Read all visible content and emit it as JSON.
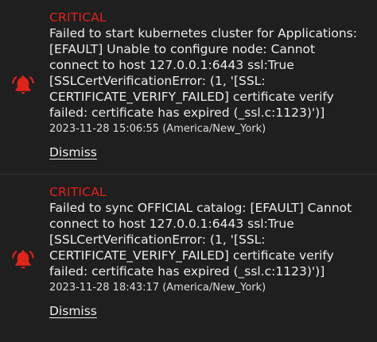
{
  "alerts": [
    {
      "level": "CRITICAL",
      "message": "Failed to start kubernetes cluster for Applications:\n[EFAULT] Unable to configure node: Cannot\nconnect to host 127.0.0.1:6443 ssl:True\n[SSLCertVerificationError: (1, '[SSL:\nCERTIFICATE_VERIFY_FAILED] certificate verify\nfailed: certificate has expired (_ssl.c:1123)')]",
      "timestamp": "2023-11-28 15:06:55 (America/New_York)",
      "dismiss_label": "Dismiss",
      "icon": "bell-icon"
    },
    {
      "level": "CRITICAL",
      "message": "Failed to sync OFFICIAL catalog: [EFAULT] Cannot\nconnect to host 127.0.0.1:6443 ssl:True\n[SSLCertVerificationError: (1, '[SSL:\nCERTIFICATE_VERIFY_FAILED] certificate verify\nfailed: certificate has expired (_ssl.c:1123)')]",
      "timestamp": "2023-11-28 18:43:17 (America/New_York)",
      "dismiss_label": "Dismiss",
      "icon": "bell-icon"
    }
  ],
  "colors": {
    "background": "#1f1f1f",
    "critical": "#e2231a",
    "text": "#ececec"
  }
}
